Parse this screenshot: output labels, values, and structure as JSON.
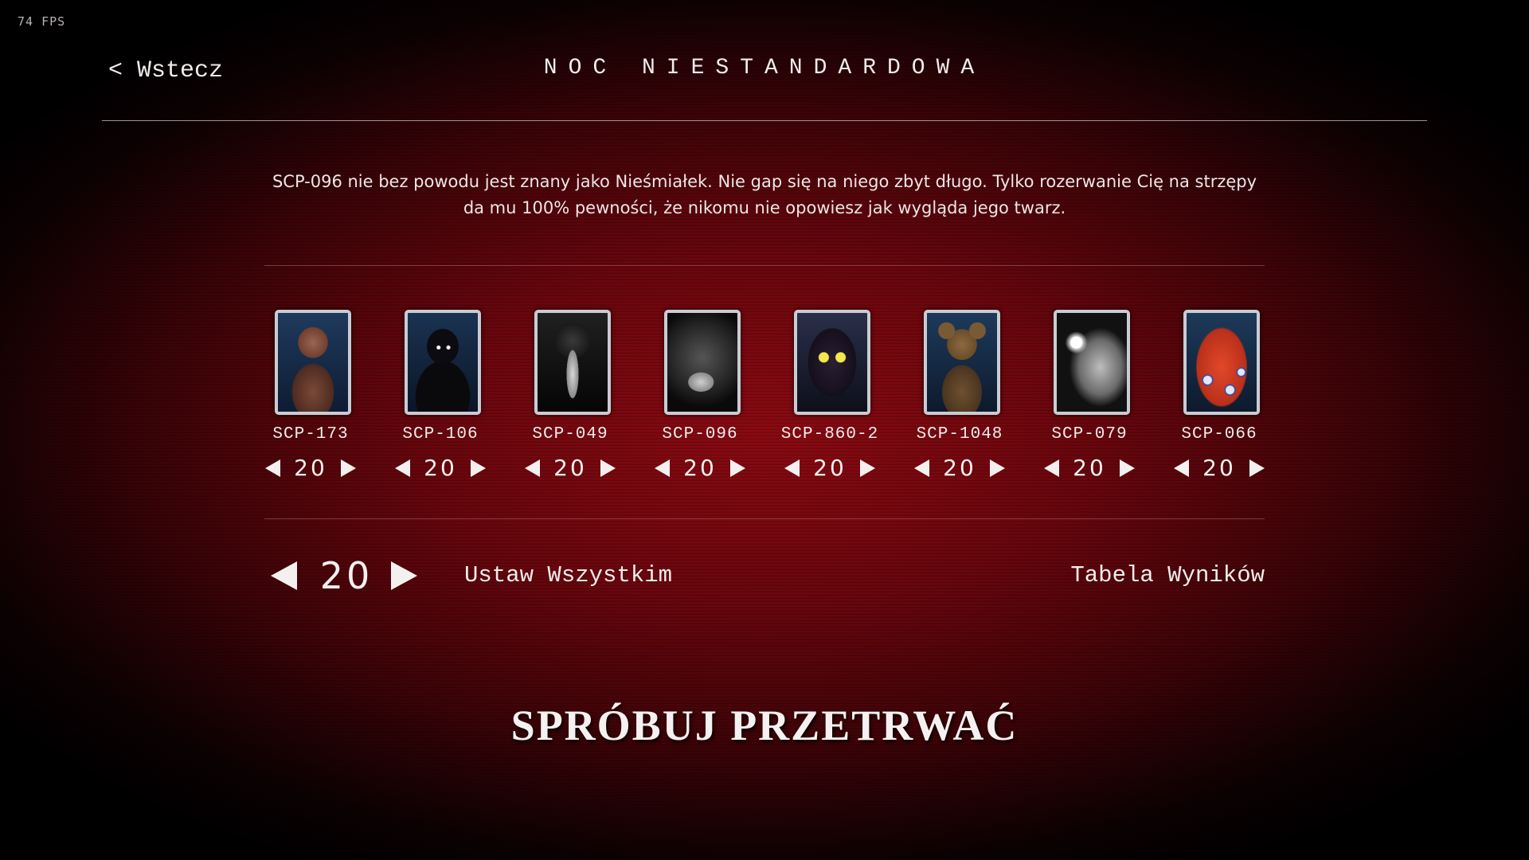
{
  "fps": "74 FPS",
  "back_label": "< Wstecz",
  "title": "NOC NIESTANDARDOWA",
  "description": "SCP-096 nie bez powodu jest znany jako Nieśmiałek. Nie gap się na niego zbyt długo. Tylko rozerwanie Cię na strzępy da mu 100% pewności, że nikomu nie opowiesz jak wygląda jego twarz.",
  "characters": [
    {
      "name": "SCP-173",
      "level": "20",
      "icon": "sculpture-portrait"
    },
    {
      "name": "SCP-106",
      "level": "20",
      "icon": "old-man-portrait"
    },
    {
      "name": "SCP-049",
      "level": "20",
      "icon": "plague-doctor-portrait"
    },
    {
      "name": "SCP-096",
      "level": "20",
      "icon": "shy-guy-portrait"
    },
    {
      "name": "SCP-860-2",
      "level": "20",
      "icon": "forest-creature-portrait"
    },
    {
      "name": "SCP-1048",
      "level": "20",
      "icon": "teddy-bear-portrait"
    },
    {
      "name": "SCP-079",
      "level": "20",
      "icon": "old-ai-portrait"
    },
    {
      "name": "SCP-066",
      "level": "20",
      "icon": "eric-toy-portrait"
    }
  ],
  "global_level": "20",
  "set_all_label": "Ustaw Wszystkim",
  "scoreboard_label": "Tabela Wyników",
  "start_label": "SPRÓBUJ PRZETRWAĆ",
  "colors": {
    "background": "#6a060d",
    "text": "#f1ecec",
    "frame": "#c9ccd3"
  }
}
